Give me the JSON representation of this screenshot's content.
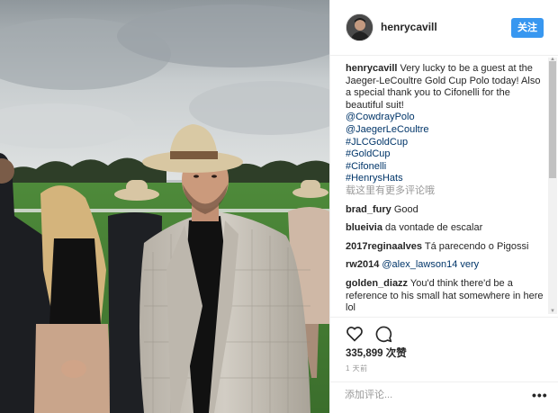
{
  "post": {
    "username": "henrycavill",
    "follow_label": "关注"
  },
  "caption": {
    "username": "henrycavill",
    "text": "Very lucky to be a guest at the Jaeger-LeCoultre Gold Cup Polo today! Also a special thank you to Cifonelli for the beautiful suit!",
    "links": [
      "@CowdrayPolo",
      "@JaegerLeCoultre",
      "#JLCGoldCup",
      "#GoldCup",
      "#Cifonelli",
      "#HenrysHats"
    ]
  },
  "more_comments": "载这里有更多评论哦",
  "comments": [
    {
      "user": "brad_fury",
      "text": "Good"
    },
    {
      "user": "blueivia",
      "text": "da vontade de escalar"
    },
    {
      "user": "2017reginaalves",
      "text": "Tá parecendo o Pigossi"
    },
    {
      "user": "rw2014",
      "text": "@alex_lawson14 very"
    },
    {
      "user": "golden_diazz",
      "text": "You'd think there'd be a reference to his small hat somewhere in here lol"
    }
  ],
  "likes": "335,899 次赞",
  "time": "1 天前",
  "add_comment": {
    "placeholder": "添加评论..."
  },
  "colors": {
    "accent": "#3897f0",
    "link": "#003569",
    "muted": "#999999",
    "text": "#262626"
  },
  "icons": [
    "heart-icon",
    "comment-icon",
    "more-options-icon"
  ]
}
